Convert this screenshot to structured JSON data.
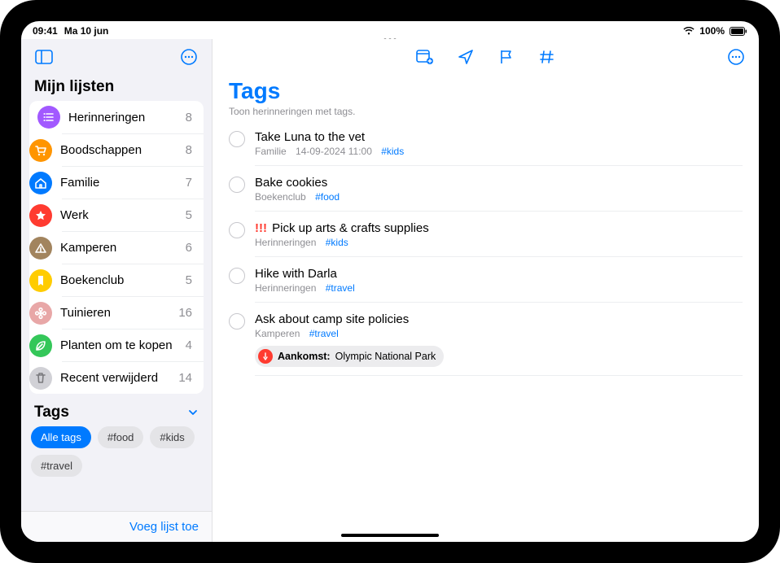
{
  "status": {
    "time": "09:41",
    "date": "Ma 10 jun",
    "battery": "100%"
  },
  "sidebar": {
    "section_title": "Mijn lijsten",
    "lists": [
      {
        "label": "Herinneringen",
        "count": 8,
        "color": "#a259ff",
        "icon": "list"
      },
      {
        "label": "Boodschappen",
        "count": 8,
        "color": "#ff9500",
        "icon": "cart"
      },
      {
        "label": "Familie",
        "count": 7,
        "color": "#007aff",
        "icon": "house"
      },
      {
        "label": "Werk",
        "count": 5,
        "color": "#ff3b30",
        "icon": "star"
      },
      {
        "label": "Kamperen",
        "count": 6,
        "color": "#a2845e",
        "icon": "tent"
      },
      {
        "label": "Boekenclub",
        "count": 5,
        "color": "#ffcc00",
        "icon": "bookmark"
      },
      {
        "label": "Tuinieren",
        "count": 16,
        "color": "#e8a7a7",
        "icon": "flower"
      },
      {
        "label": "Planten om te kopen",
        "count": 4,
        "color": "#34c759",
        "icon": "leaf"
      },
      {
        "label": "Recent verwijderd",
        "count": 14,
        "color": "#d1d1d6",
        "icon": "trash"
      }
    ],
    "tags_title": "Tags",
    "tags": [
      {
        "label": "Alle tags",
        "active": true
      },
      {
        "label": "#food",
        "active": false
      },
      {
        "label": "#kids",
        "active": false
      },
      {
        "label": "#travel",
        "active": false
      }
    ],
    "add_list": "Voeg lijst toe"
  },
  "main": {
    "title": "Tags",
    "subtitle": "Toon herinneringen met tags.",
    "reminders": [
      {
        "title": "Take Luna to the vet",
        "priority": "",
        "list": "Familie",
        "date": "14-09-2024 11:00",
        "tag": "#kids"
      },
      {
        "title": "Bake cookies",
        "priority": "",
        "list": "Boekenclub",
        "date": "",
        "tag": "#food"
      },
      {
        "title": "Pick up arts & crafts supplies",
        "priority": "!!!",
        "list": "Herinneringen",
        "date": "",
        "tag": "#kids"
      },
      {
        "title": "Hike with Darla",
        "priority": "",
        "list": "Herinneringen",
        "date": "",
        "tag": "#travel"
      },
      {
        "title": "Ask about camp site policies",
        "priority": "",
        "list": "Kamperen",
        "date": "",
        "tag": "#travel",
        "arrival": {
          "label": "Aankomst:",
          "place": "Olympic National Park"
        }
      }
    ]
  }
}
